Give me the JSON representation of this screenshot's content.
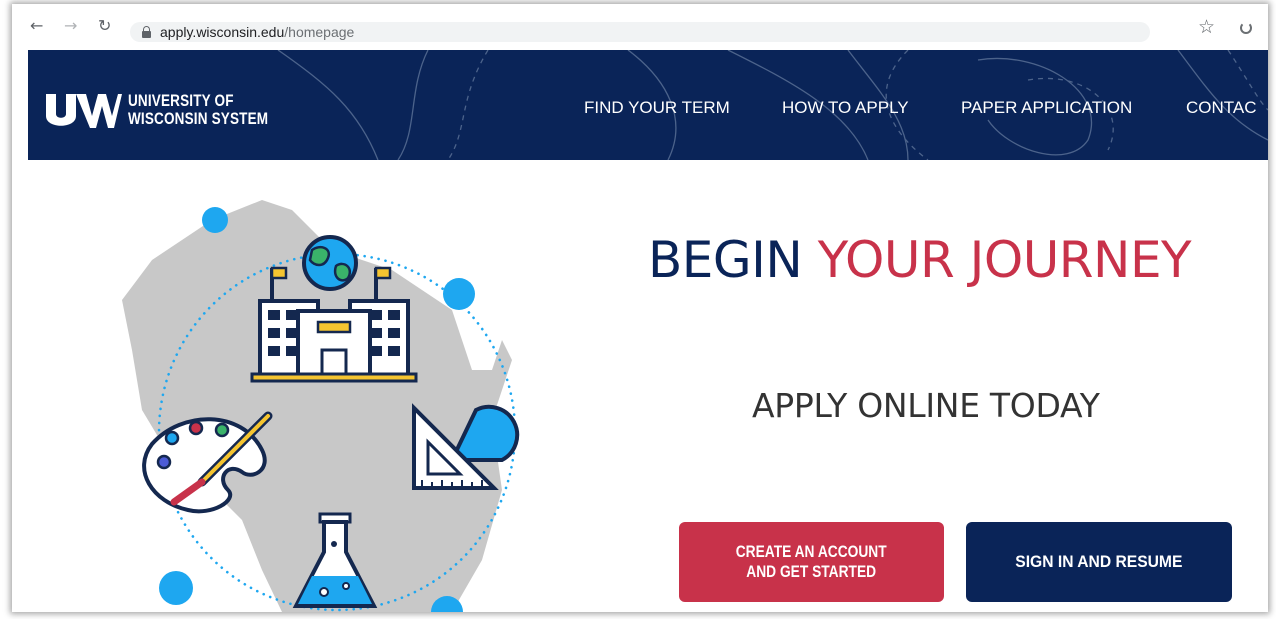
{
  "browser": {
    "back_glyph": "←",
    "forward_glyph": "→",
    "reload_glyph": "↻",
    "url_host": "apply.wisconsin.edu",
    "url_path": "/homepage",
    "star_glyph": "☆",
    "icons": [
      "back-arrow-icon",
      "forward-arrow-icon",
      "reload-icon",
      "lock-icon",
      "star-icon",
      "extension-icon"
    ]
  },
  "header": {
    "logo_line1": "UNIVERSITY OF",
    "logo_line2": "WISCONSIN SYSTEM",
    "nav": [
      {
        "label": "FIND YOUR TERM"
      },
      {
        "label": "HOW TO APPLY"
      },
      {
        "label": "PAPER APPLICATION"
      },
      {
        "label": "CONTAC"
      }
    ],
    "colors": {
      "background": "#0a2458"
    }
  },
  "hero": {
    "title_part1": "BEGIN",
    "title_part2": "YOUR JOURNEY",
    "subtitle": "APPLY ONLINE TODAY",
    "illustration_icons": [
      "wisconsin-map-icon",
      "globe-icon",
      "school-building-icon",
      "paint-palette-icon",
      "ruler-protractor-icon",
      "flask-icon"
    ]
  },
  "buttons": {
    "create_line1": "CREATE AN ACCOUNT",
    "create_line2": "AND GET STARTED",
    "signin": "SIGN IN AND RESUME"
  },
  "colors": {
    "navy": "#0a2458",
    "red": "#c8324a",
    "accent_blue": "#1ea7f0",
    "map_gray": "#c8c8c8"
  }
}
